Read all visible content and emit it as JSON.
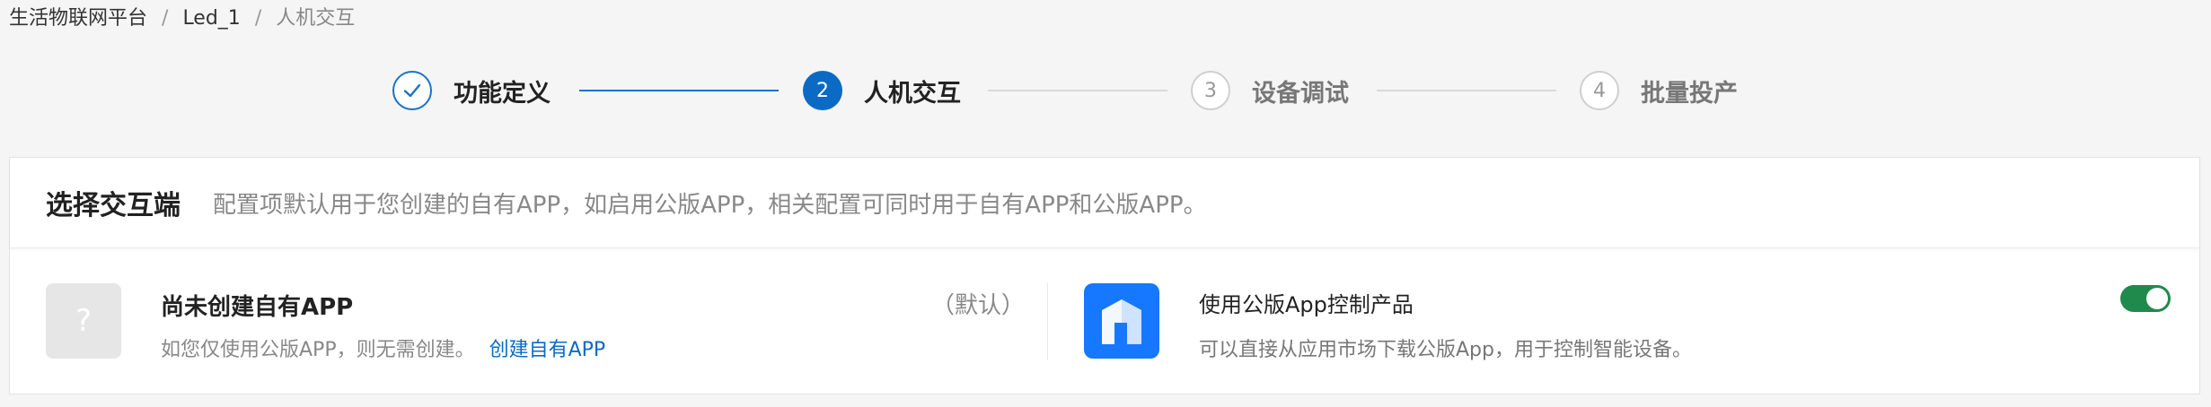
{
  "breadcrumb": {
    "items": [
      "生活物联网平台",
      "Led_1",
      "人机交互"
    ],
    "separator": "/"
  },
  "steps": [
    {
      "number": "",
      "label": "功能定义",
      "state": "done"
    },
    {
      "number": "2",
      "label": "人机交互",
      "state": "active"
    },
    {
      "number": "3",
      "label": "设备调试",
      "state": "pending"
    },
    {
      "number": "4",
      "label": "批量投产",
      "state": "pending"
    }
  ],
  "card": {
    "title": "选择交互端",
    "description": "配置项默认用于您创建的自有APP，如启用公版APP，相关配置可同时用于自有APP和公版APP。",
    "own_app": {
      "icon_glyph": "?",
      "title": "尚未创建自有APP",
      "default_tag": "（默认）",
      "description": "如您仅使用公版APP，则无需创建。",
      "create_link": "创建自有APP"
    },
    "public_app": {
      "title": "使用公版App控制产品",
      "description": "可以直接从应用市场下载公版App，用于控制智能设备。",
      "enabled": true
    }
  },
  "colors": {
    "primary": "#0b6bc4",
    "toggle_on": "#1f8a4c",
    "app_icon": "#1677ff"
  }
}
